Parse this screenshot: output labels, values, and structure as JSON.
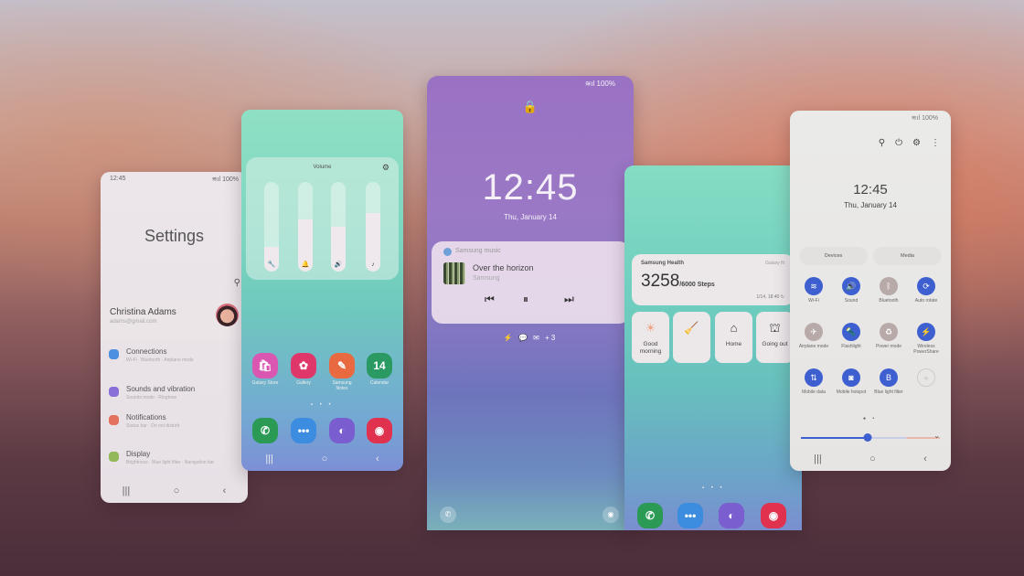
{
  "settings_phone": {
    "status_time": "12:45",
    "status_right": "100%",
    "title": "Settings",
    "search_icon": "search-icon",
    "profile": {
      "name": "Christina Adams",
      "email": "adams@gmail.com"
    },
    "items": [
      {
        "label": "Connections",
        "sub": "Wi-Fi  ·  Bluetooth  ·  Airplane mode",
        "icon": "wifi-icon",
        "color": "#4d8fe0"
      },
      {
        "label": "Sounds and vibration",
        "sub": "Sounds mode  ·  Ringtone",
        "icon": "volume-icon",
        "color": "#8a6fd8"
      },
      {
        "label": "Notifications",
        "sub": "Status bar  ·  Do not disturb",
        "icon": "notification-icon",
        "color": "#e4705e"
      },
      {
        "label": "Display",
        "sub": "Brightness  ·  Blue light filter  ·  Navigation bar",
        "icon": "display-icon",
        "color": "#93b85a"
      }
    ],
    "nav": {
      "recents": "|||",
      "home": "○",
      "back": "‹"
    }
  },
  "volume_phone": {
    "panel_title": "Volume",
    "sliders": [
      {
        "name": "system",
        "icon": "wrench-icon",
        "glyph": "🔧",
        "level": 0.28
      },
      {
        "name": "ringtone",
        "icon": "bell-icon",
        "glyph": "🔔",
        "level": 0.58
      },
      {
        "name": "media",
        "icon": "speaker-icon",
        "glyph": "🔊",
        "level": 0.5
      },
      {
        "name": "music",
        "icon": "music-note-icon",
        "glyph": "♪",
        "level": 0.65
      }
    ],
    "apps": [
      {
        "label": "Galaxy Store",
        "glyph": "🛍",
        "color": "#d957b0"
      },
      {
        "label": "Gallery",
        "glyph": "✿",
        "color": "#e0376a"
      },
      {
        "label": "Samsung Notes",
        "glyph": "✎",
        "color": "#e96a40"
      },
      {
        "label": "Calendar",
        "glyph": "14",
        "color": "#2a9a62"
      }
    ],
    "dock": [
      {
        "label": "Phone",
        "glyph": "✆",
        "color": "#2a9a55"
      },
      {
        "label": "Messages",
        "glyph": "•••",
        "color": "#3c8ce0"
      },
      {
        "label": "Internet",
        "glyph": "◐",
        "color": "#7a5ed0"
      },
      {
        "label": "Camera",
        "glyph": "◉",
        "color": "#e0324f"
      }
    ],
    "page_dots": "▪ • •"
  },
  "lock_phone": {
    "status_right": "100%",
    "time": "12:45",
    "date": "Thu, January 14",
    "music": {
      "app": "Samsung music",
      "song": "Over the horizon",
      "artist": "Samsung",
      "prev": "⏮",
      "pause": "⏸",
      "next": "⏭"
    },
    "notifications": "⚡ 💬 ✉ +3",
    "left_shortcut": "✆",
    "right_shortcut": "◉"
  },
  "health_phone": {
    "health": {
      "app": "Samsung Health",
      "source": "Galaxy fit",
      "steps": "3258",
      "goal": "/6000 Steps",
      "updated": "1/14, 18:40 ↻"
    },
    "modes": [
      {
        "label": "Good morning",
        "glyph": "☀",
        "color": "#f0a080"
      },
      {
        "label": "",
        "glyph": "🧹",
        "color": "#3c7ce0"
      },
      {
        "label": "Home",
        "glyph": "⌂",
        "color": "#333"
      },
      {
        "label": "Going out",
        "glyph": "⛫",
        "color": "#333"
      }
    ],
    "page_dots": "▪ • •",
    "dock": [
      {
        "label": "Phone",
        "glyph": "✆",
        "color": "#2a9a55"
      },
      {
        "label": "Messages",
        "glyph": "•••",
        "color": "#3c8ce0"
      },
      {
        "label": "Internet",
        "glyph": "◐",
        "color": "#7a5ed0"
      },
      {
        "label": "Camera",
        "glyph": "◉",
        "color": "#e0324f"
      }
    ]
  },
  "quick_phone": {
    "status_right": "100%",
    "tools": [
      "⚲",
      "⏻",
      "⚙",
      "⋮"
    ],
    "time": "12:45",
    "date": "Thu, January 14",
    "buttons": [
      "Devices",
      "Media"
    ],
    "tiles": [
      {
        "label": "Wi-Fi",
        "glyph": "≋",
        "active": true
      },
      {
        "label": "Sound",
        "glyph": "🔊",
        "active": true
      },
      {
        "label": "Bluetooth",
        "glyph": "ᛒ",
        "active": false
      },
      {
        "label": "Auto rotate",
        "glyph": "⟳",
        "active": true
      },
      {
        "label": "Airplane mode",
        "glyph": "✈",
        "active": false
      },
      {
        "label": "Flashlight",
        "glyph": "🔦",
        "active": true
      },
      {
        "label": "Power mode",
        "glyph": "♻",
        "active": false
      },
      {
        "label": "Wireless PowerShare",
        "glyph": "⚡",
        "active": true
      },
      {
        "label": "Mobile data",
        "glyph": "⇅",
        "active": true
      },
      {
        "label": "Mobile hotspot",
        "glyph": "◙",
        "active": true
      },
      {
        "label": "Blue light filter",
        "glyph": "B",
        "active": true
      },
      {
        "label": "",
        "glyph": "+",
        "active": null
      }
    ],
    "page_dots": "● •",
    "brightness": 0.48,
    "expand": "⌄",
    "colors": {
      "active": "#3d5fd0",
      "inactive": "#b8aaa8"
    }
  }
}
